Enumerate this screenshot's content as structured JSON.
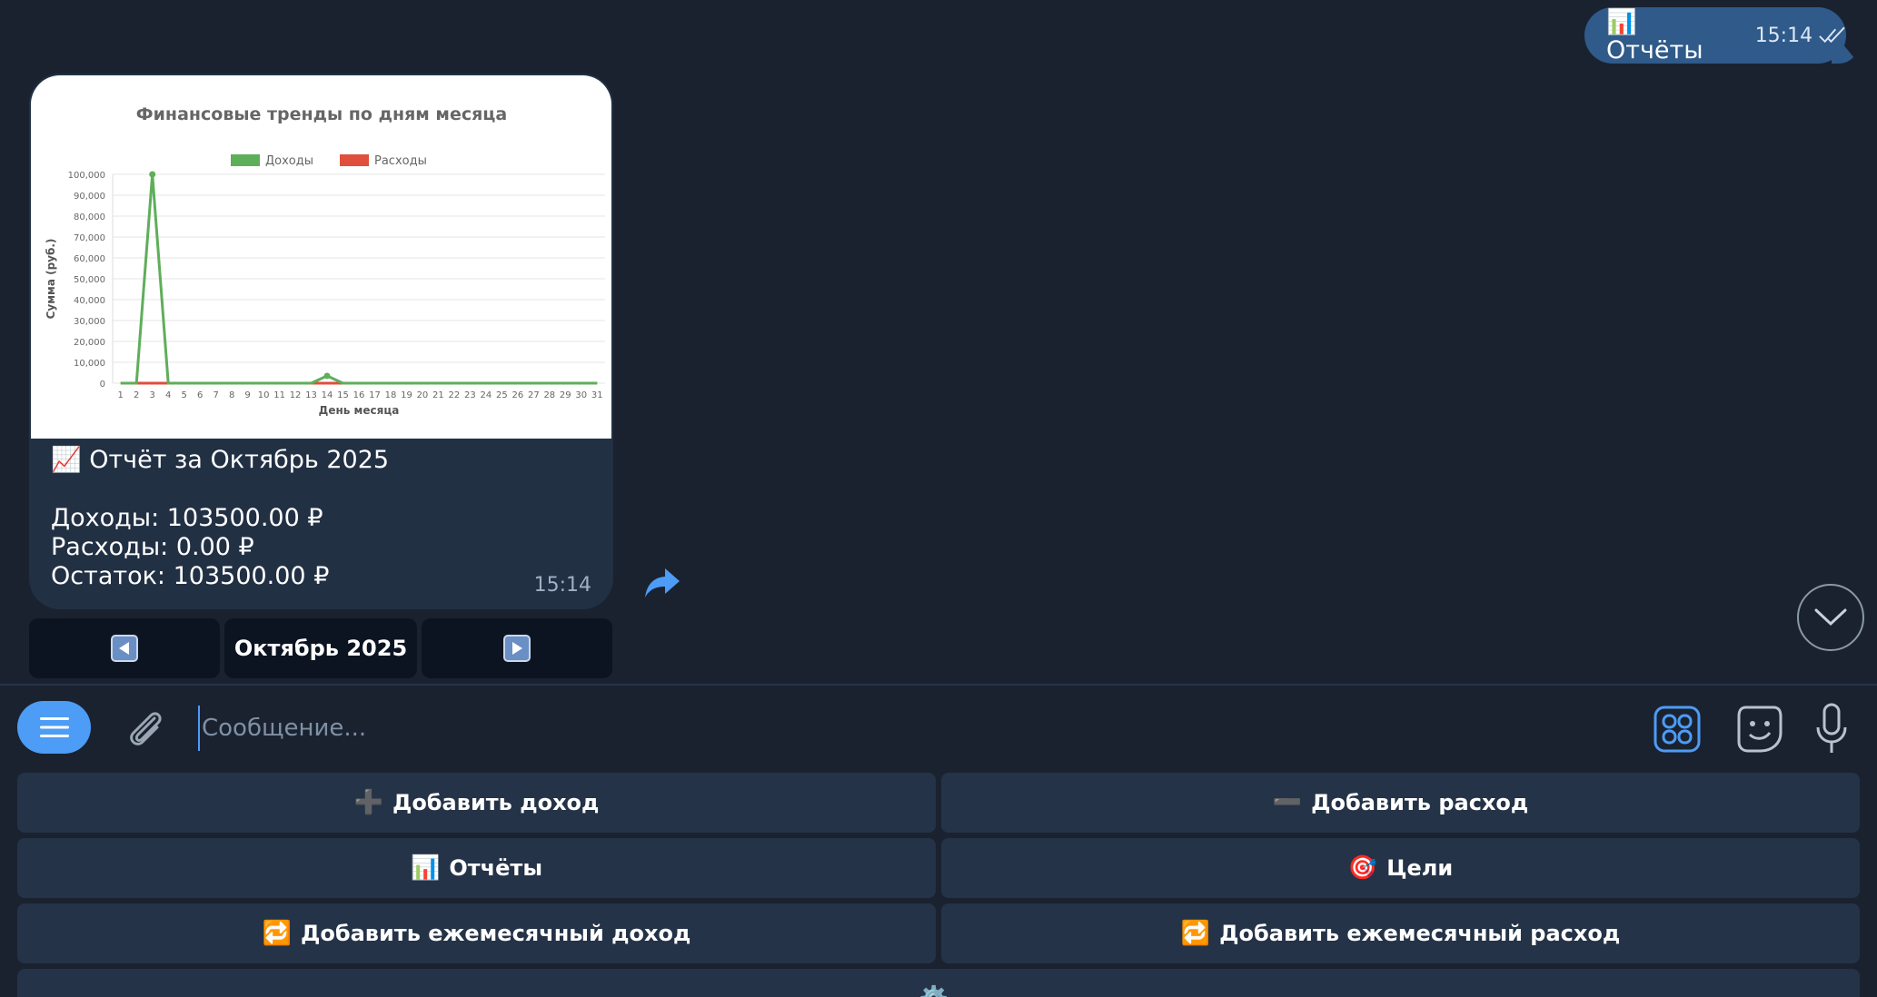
{
  "outgoing": {
    "icon": "bar-chart-icon",
    "text": "📊 Отчёты",
    "time": "15:14"
  },
  "report": {
    "title": "📈 Отчёт за Октябрь 2025",
    "income": "Доходы: 103500.00 ₽",
    "expense": "Расходы: 0.00 ₽",
    "balance": "Остаток: 103500.00 ₽",
    "time": "15:14"
  },
  "chart_data": {
    "type": "line",
    "title": "Финансовые тренды по дням месяца",
    "xlabel": "День месяца",
    "ylabel": "Сумма (руб.)",
    "legend": "top",
    "grid": true,
    "ylim": [
      0,
      100000
    ],
    "yticks": [
      0,
      10000,
      20000,
      30000,
      40000,
      50000,
      60000,
      70000,
      80000,
      90000,
      100000
    ],
    "ytick_labels": [
      "0",
      "10,000",
      "20,000",
      "30,000",
      "40,000",
      "50,000",
      "60,000",
      "70,000",
      "80,000",
      "90,000",
      "100,000"
    ],
    "categories": [
      "1",
      "2",
      "3",
      "4",
      "5",
      "6",
      "7",
      "8",
      "9",
      "10",
      "11",
      "12",
      "13",
      "14",
      "15",
      "16",
      "17",
      "18",
      "19",
      "20",
      "21",
      "22",
      "23",
      "24",
      "25",
      "26",
      "27",
      "28",
      "29",
      "30",
      "31"
    ],
    "series": [
      {
        "name": "Доходы",
        "color": "#5fae5a",
        "values": [
          0,
          0,
          100000,
          0,
          0,
          0,
          0,
          0,
          0,
          0,
          0,
          0,
          0,
          3500,
          0,
          0,
          0,
          0,
          0,
          0,
          0,
          0,
          0,
          0,
          0,
          0,
          0,
          0,
          0,
          0,
          0
        ]
      },
      {
        "name": "Расходы",
        "color": "#e04e3e",
        "values": [
          0,
          0,
          0,
          0,
          0,
          0,
          0,
          0,
          0,
          0,
          0,
          0,
          0,
          0,
          0,
          0,
          0,
          0,
          0,
          0,
          0,
          0,
          0,
          0,
          0,
          0,
          0,
          0,
          0,
          0,
          0
        ]
      }
    ]
  },
  "inline_keyboard": {
    "prev_icon": "left-arrow-icon",
    "month": "Октябрь 2025",
    "next_icon": "right-arrow-icon"
  },
  "composer": {
    "placeholder": "Сообщение..."
  },
  "keyboard": {
    "add_income": "Добавить доход",
    "add_income_icon": "➕",
    "add_expense": "Добавить расход",
    "add_expense_icon": "➖",
    "reports": "Отчёты",
    "reports_icon": "📊",
    "goals": "Цели",
    "goals_icon": "🎯",
    "add_monthly_income": "Добавить ежемесячный доход",
    "add_monthly_income_icon": "🔁",
    "add_monthly_expense": "Добавить ежемесячный расход",
    "add_monthly_expense_icon": "🔁",
    "settings_icon": "⚙️"
  },
  "colors": {
    "background": "#1a2230",
    "outgoing_bubble": "#2f5a8a",
    "incoming_bubble": "#223044",
    "accent": "#4d9cf6",
    "income": "#5fae5a",
    "expense": "#e04e3e"
  }
}
